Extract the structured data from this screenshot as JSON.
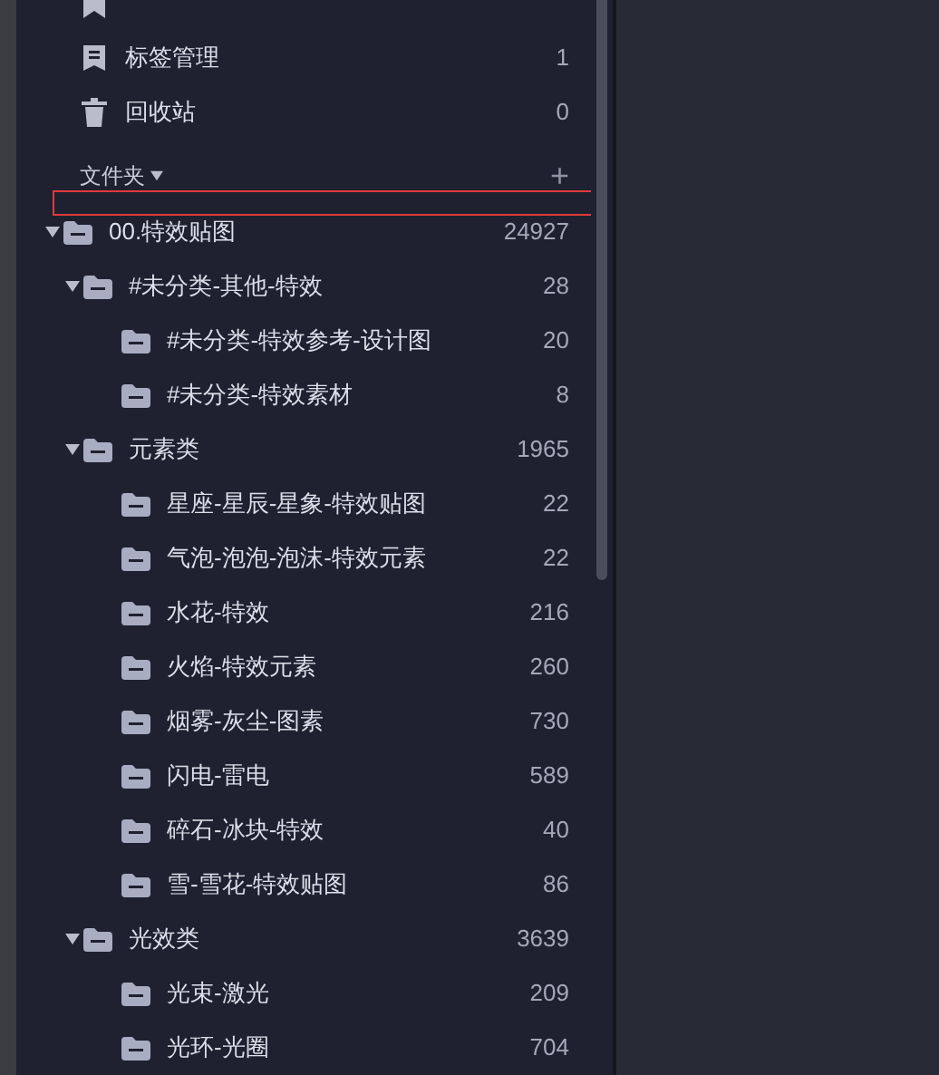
{
  "nav_items": [
    {
      "kind": "tag"
    },
    {
      "kind": "manage",
      "label": "标签管理",
      "count": "1"
    },
    {
      "kind": "trash",
      "label": "回收站",
      "count": "0"
    }
  ],
  "folders_header": {
    "label": "文件夹",
    "add": "+"
  },
  "folder_tree": [
    {
      "label": "00.特效贴图",
      "count": "24927",
      "expanded": true,
      "children": [
        {
          "label": "#未分类-其他-特效",
          "count": "28",
          "expanded": true,
          "children": [
            {
              "label": "#未分类-特效参考-设计图",
              "count": "20"
            },
            {
              "label": "#未分类-特效素材",
              "count": "8"
            }
          ]
        },
        {
          "label": "元素类",
          "count": "1965",
          "expanded": true,
          "children": [
            {
              "label": "星座-星辰-星象-特效贴图",
              "count": "22"
            },
            {
              "label": "气泡-泡泡-泡沫-特效元素",
              "count": "22"
            },
            {
              "label": "水花-特效",
              "count": "216"
            },
            {
              "label": "火焰-特效元素",
              "count": "260"
            },
            {
              "label": "烟雾-灰尘-图素",
              "count": "730"
            },
            {
              "label": "闪电-雷电",
              "count": "589"
            },
            {
              "label": "碎石-冰块-特效",
              "count": "40"
            },
            {
              "label": "雪-雪花-特效贴图",
              "count": "86"
            }
          ]
        },
        {
          "label": "光效类",
          "count": "3639",
          "expanded": true,
          "children": [
            {
              "label": "光束-激光",
              "count": "209"
            },
            {
              "label": "光环-光圈",
              "count": "704"
            }
          ]
        }
      ]
    }
  ]
}
